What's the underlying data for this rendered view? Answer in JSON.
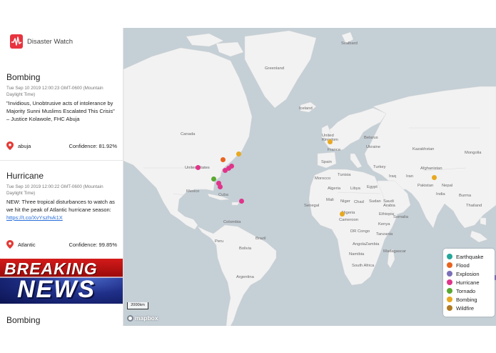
{
  "brand": {
    "name": "Disaster Watch",
    "logo_icon": "disaster-watch-logo-icon",
    "accent": "#e8343f"
  },
  "cards": [
    {
      "title": "Bombing",
      "time": "Tue Sep 10 2019 12:00:23 GMT-0600 (Mountain Daylight Time)",
      "text": "\"Invidious, Unobtrusive acts of intolerance by Majority Sunni Muslims Escalated This Crisis\" – Justice Kolawole, FHC Abuja",
      "location": "abuja",
      "confidence": "Confidence: 81.92%"
    },
    {
      "title": "Hurricane",
      "time": "Tue Sep 10 2019 12:00:22 GMT-0600 (Mountain Daylight Time)",
      "text": "NEW: Three tropical disturbances to watch as we hit the peak of Atlantic hurricane season:",
      "link": "https://t.co/XvYszhvk1X",
      "location": "Atlantic",
      "confidence": "Confidence: 99.85%"
    },
    {
      "title": "Bombing"
    }
  ],
  "breaking_news": {
    "line1": "BREAKING",
    "line2": "NEWS"
  },
  "map": {
    "labels": {
      "svalbard": "Svalbard",
      "greenland": "Greenland",
      "iceland": "Iceland",
      "canada": "Canada",
      "united_states": "United States",
      "mexico": "Mexico",
      "cuba": "Cuba",
      "colombia": "Colombia",
      "peru": "Peru",
      "brazil": "Brazil",
      "bolivia": "Bolivia",
      "argentina": "Argentina",
      "united_kingdom": "United Kingdom",
      "france": "France",
      "spain": "Spain",
      "belarus": "Belarus",
      "ukraine": "Ukraine",
      "kazakhstan": "Kazakhstan",
      "turkey": "Turkey",
      "mongolia": "Mongolia",
      "tunisia": "Tunisia",
      "morocco": "Morocco",
      "algeria": "Algeria",
      "libya": "Libya",
      "egypt": "Egypt",
      "iraq": "Iraq",
      "iran": "Iran",
      "afghanistan": "Afghanistan",
      "pakistan": "Pakistan",
      "nepal": "Nepal",
      "india": "India",
      "saudi_arabia": "Saudi Arabia",
      "mali": "Mali",
      "niger": "Niger",
      "chad": "Chad",
      "sudan": "Sudan",
      "senegal": "Senegal",
      "nigeria": "Nigeria",
      "cameroon": "Cameroon",
      "ethiopia": "Ethiopia",
      "kenya": "Kenya",
      "somalia": "Somalia",
      "dr_congo": "DR Congo",
      "tanzania": "Tanzania",
      "angola": "Angola",
      "zambia": "Zambia",
      "namibia": "Namibia",
      "madagascar": "Madagascar",
      "south_africa": "South Africa",
      "burma": "Burma",
      "thailand": "Thailand",
      "sudan2": "Sudan"
    },
    "scale": "2000km",
    "attribution": "mapbox"
  },
  "legend": [
    {
      "label": "Earthquake",
      "color": "#26a69a"
    },
    {
      "label": "Flood",
      "color": "#e8641e"
    },
    {
      "label": "Explosion",
      "color": "#7a6fb8"
    },
    {
      "label": "Hurricane",
      "color": "#e0348a"
    },
    {
      "label": "Tornado",
      "color": "#5aa832"
    },
    {
      "label": "Bombing",
      "color": "#e8a820"
    },
    {
      "label": "Wildfire",
      "color": "#b07a22"
    }
  ]
}
